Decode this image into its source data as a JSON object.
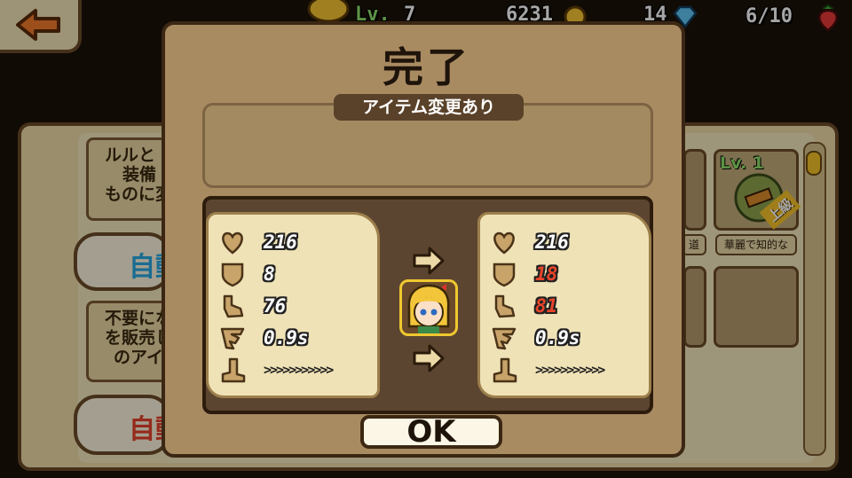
{
  "hud": {
    "level_label": "Lv.",
    "level_value": "7",
    "gold": "6231",
    "gems": "14",
    "stamina": "6/10"
  },
  "background": {
    "card_top_lines": [
      "ルルと",
      "装備",
      "ものに変"
    ],
    "auto_button_1": "自動",
    "card_bottom_lines": [
      "不要にな",
      "を販売し",
      "のアイテ"
    ],
    "auto_button_2": "自動",
    "item_level": "Lv. 1",
    "item_rank": "上級",
    "slot_label_partial": "道",
    "slot_label_full": "華麗で知的な"
  },
  "modal": {
    "title": "完了",
    "subtitle": "アイテム変更あり",
    "before_stats": [
      {
        "icon": "heart-icon",
        "value": "216",
        "changed": false
      },
      {
        "icon": "shield-icon",
        "value": "8",
        "changed": false
      },
      {
        "icon": "fist-icon",
        "value": "76",
        "changed": false
      },
      {
        "icon": "wing-icon",
        "value": "0.9s",
        "changed": false
      }
    ],
    "after_stats": [
      {
        "icon": "heart-icon",
        "value": "216",
        "changed": false
      },
      {
        "icon": "shield-icon",
        "value": "18",
        "changed": true
      },
      {
        "icon": "fist-icon",
        "value": "81",
        "changed": true
      },
      {
        "icon": "wing-icon",
        "value": "0.9s",
        "changed": false
      }
    ],
    "speed_chevrons": ">>>>>>>>>>>",
    "ok_label": "OK"
  },
  "colors": {
    "increase": "#e9452a",
    "accent_red": "#e5412c",
    "accent_blue": "#27a6e0"
  }
}
